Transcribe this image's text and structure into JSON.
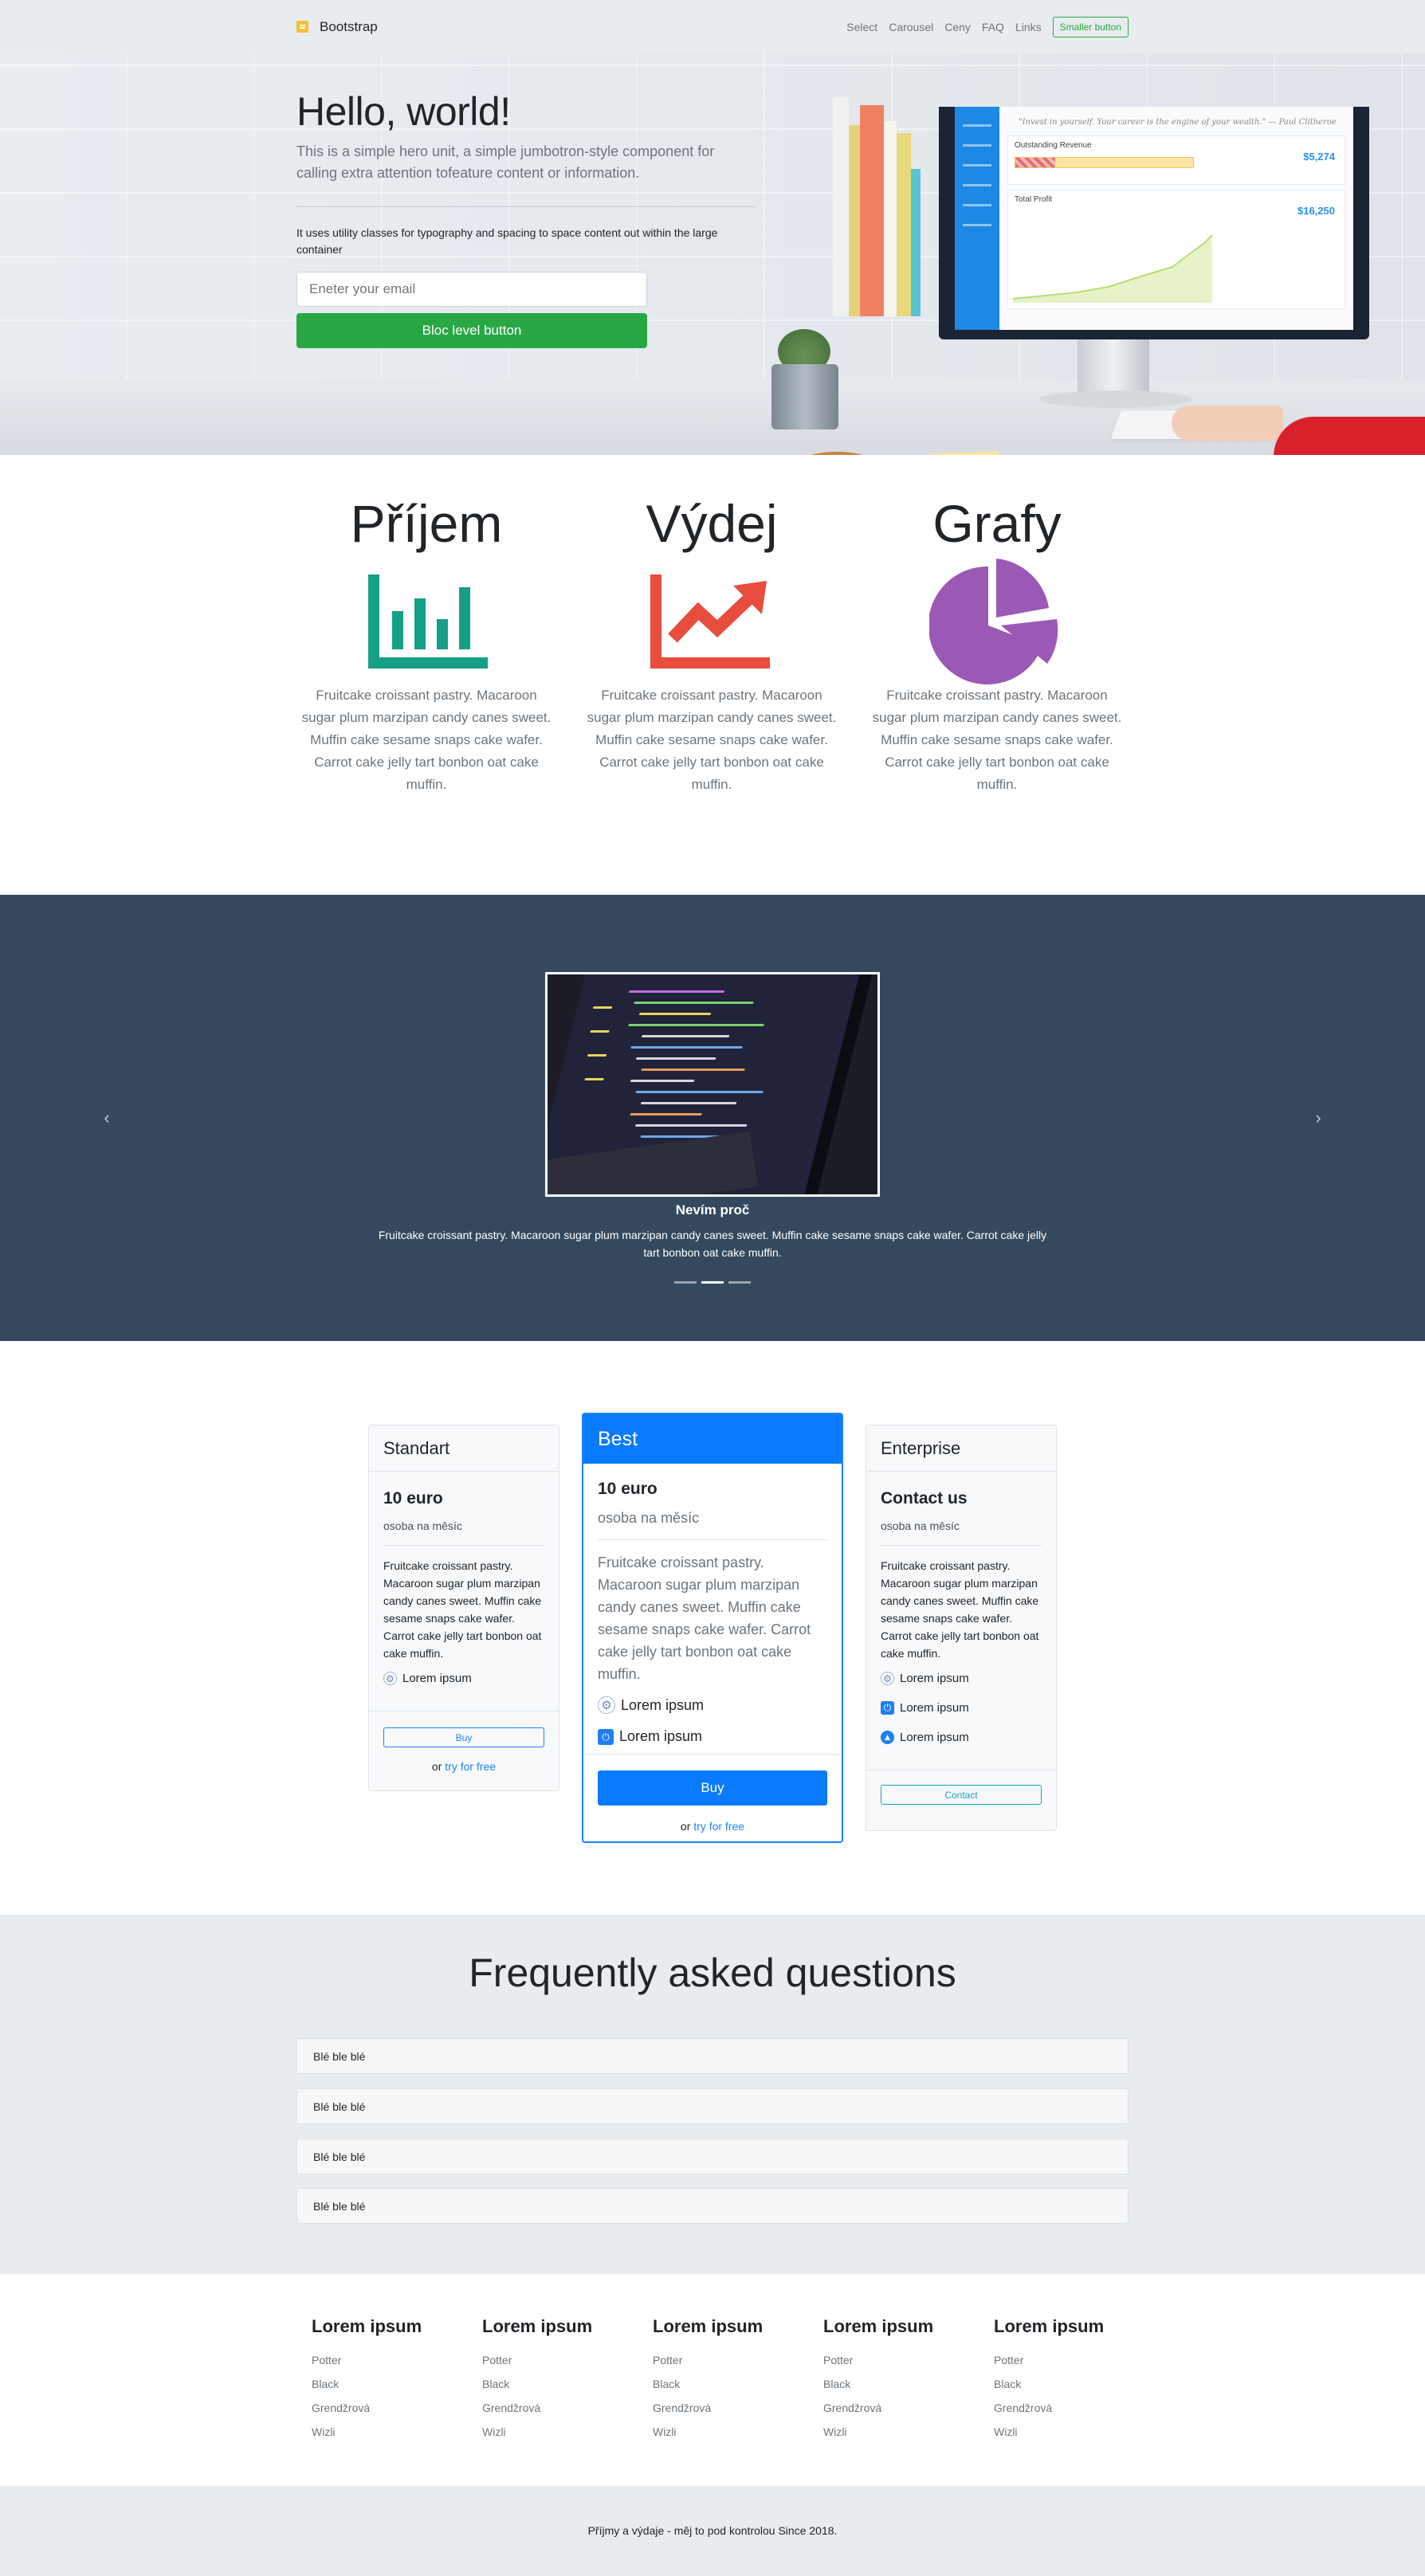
{
  "navbar": {
    "brand": "Bootstrap",
    "links": [
      "Select",
      "Carousel",
      "Ceny",
      "FAQ",
      "Links"
    ],
    "button": "Smaller button"
  },
  "hero": {
    "title": "Hello, world!",
    "lead": "This is a simple hero unit, a simple jumbotron-style component for calling extra attention tofeature content or information.",
    "text": "It uses utility classes for typography and spacing to space content out within the large container",
    "email_placeholder": "Eneter your email",
    "button": "Bloc level button",
    "monitor": {
      "quote": "\"Invest in yourself. Your career is the engine of your wealth.\" — Paul Clitheroe",
      "card1_title": "Outstanding Revenue",
      "card1_value": "$5,274",
      "card2_title": "Total Profit",
      "card2_value": "$16,250"
    }
  },
  "features": [
    {
      "title": "Příjem",
      "icon": "bar-chart-icon",
      "color": "#16a085",
      "text": "Fruitcake croissant pastry. Macaroon sugar plum marzipan candy canes sweet. Muffin cake sesame snaps cake wafer. Carrot cake jelly tart bonbon oat cake muffin."
    },
    {
      "title": "Výdej",
      "icon": "line-chart-icon",
      "color": "#e74c3c",
      "text": "Fruitcake croissant pastry. Macaroon sugar plum marzipan candy canes sweet. Muffin cake sesame snaps cake wafer. Carrot cake jelly tart bonbon oat cake muffin."
    },
    {
      "title": "Grafy",
      "icon": "pie-chart-icon",
      "color": "#9b59b6",
      "text": "Fruitcake croissant pastry. Macaroon sugar plum marzipan candy canes sweet. Muffin cake sesame snaps cake wafer. Carrot cake jelly tart bonbon oat cake muffin."
    }
  ],
  "carousel": {
    "caption_title": "Nevím proč",
    "caption_text": "Fruitcake croissant pastry. Macaroon sugar plum marzipan candy canes sweet. Muffin cake sesame snaps cake wafer. Carrot cake jelly tart bonbon oat cake muffin.",
    "slides": 3,
    "active_slide": 2,
    "prev_icon": "chevron-left-icon",
    "next_icon": "chevron-right-icon"
  },
  "pricing": [
    {
      "name": "Standart",
      "price": "10 euro",
      "per": "osoba na měsíc",
      "desc": "Fruitcake croissant pastry. Macaroon sugar plum marzipan candy canes sweet. Muffin cake sesame snaps cake wafer. Carrot cake jelly tart bonbon oat cake muffin.",
      "features": [
        "Lorem ipsum"
      ],
      "button": "Buy",
      "or": "or",
      "try": "try for free"
    },
    {
      "name": "Best",
      "price": "10 euro",
      "per": "osoba na měsíc",
      "desc": "Fruitcake croissant pastry. Macaroon sugar plum marzipan candy canes sweet. Muffin cake sesame snaps cake wafer. Carrot cake jelly tart bonbon oat cake muffin.",
      "features": [
        "Lorem ipsum",
        "Lorem ipsum"
      ],
      "button": "Buy",
      "or": "or",
      "try": "try for free"
    },
    {
      "name": "Enterprise",
      "price": "Contact us",
      "per": "osoba na měsíc",
      "desc": "Fruitcake croissant pastry. Macaroon sugar plum marzipan candy canes sweet. Muffin cake sesame snaps cake wafer. Carrot cake jelly tart bonbon oat cake muffin.",
      "features": [
        "Lorem ipsum",
        "Lorem ipsum",
        "Lorem ipsum"
      ],
      "button": "Contact"
    }
  ],
  "faq": {
    "title": "Frequently asked questions",
    "items": [
      "Blé ble blé",
      "Blé ble blé",
      "Blé ble blé",
      "Blé ble blé"
    ]
  },
  "footer": {
    "columns": [
      {
        "title": "Lorem ipsum",
        "links": [
          "Potter",
          "Black",
          "Grendžrová",
          "Wizli"
        ]
      },
      {
        "title": "Lorem ipsum",
        "links": [
          "Potter",
          "Black",
          "Grendžrová",
          "Wizli"
        ]
      },
      {
        "title": "Lorem ipsum",
        "links": [
          "Potter",
          "Black",
          "Grendžrová",
          "Wizli"
        ]
      },
      {
        "title": "Lorem ipsum",
        "links": [
          "Potter",
          "Black",
          "Grendžrová",
          "Wizli"
        ]
      },
      {
        "title": "Lorem ipsum",
        "links": [
          "Potter",
          "Black",
          "Grendžrová",
          "Wizli"
        ]
      }
    ],
    "copyright": "Příjmy a výdaje - měj to pod kontrolou Since 2018."
  }
}
